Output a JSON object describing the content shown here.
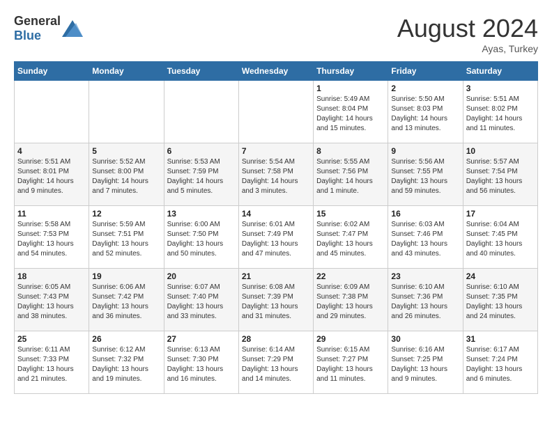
{
  "header": {
    "logo_general": "General",
    "logo_blue": "Blue",
    "month_year": "August 2024",
    "location": "Ayas, Turkey"
  },
  "days_of_week": [
    "Sunday",
    "Monday",
    "Tuesday",
    "Wednesday",
    "Thursday",
    "Friday",
    "Saturday"
  ],
  "weeks": [
    [
      {
        "day": "",
        "content": ""
      },
      {
        "day": "",
        "content": ""
      },
      {
        "day": "",
        "content": ""
      },
      {
        "day": "",
        "content": ""
      },
      {
        "day": "1",
        "content": "Sunrise: 5:49 AM\nSunset: 8:04 PM\nDaylight: 14 hours\nand 15 minutes."
      },
      {
        "day": "2",
        "content": "Sunrise: 5:50 AM\nSunset: 8:03 PM\nDaylight: 14 hours\nand 13 minutes."
      },
      {
        "day": "3",
        "content": "Sunrise: 5:51 AM\nSunset: 8:02 PM\nDaylight: 14 hours\nand 11 minutes."
      }
    ],
    [
      {
        "day": "4",
        "content": "Sunrise: 5:51 AM\nSunset: 8:01 PM\nDaylight: 14 hours\nand 9 minutes."
      },
      {
        "day": "5",
        "content": "Sunrise: 5:52 AM\nSunset: 8:00 PM\nDaylight: 14 hours\nand 7 minutes."
      },
      {
        "day": "6",
        "content": "Sunrise: 5:53 AM\nSunset: 7:59 PM\nDaylight: 14 hours\nand 5 minutes."
      },
      {
        "day": "7",
        "content": "Sunrise: 5:54 AM\nSunset: 7:58 PM\nDaylight: 14 hours\nand 3 minutes."
      },
      {
        "day": "8",
        "content": "Sunrise: 5:55 AM\nSunset: 7:56 PM\nDaylight: 14 hours\nand 1 minute."
      },
      {
        "day": "9",
        "content": "Sunrise: 5:56 AM\nSunset: 7:55 PM\nDaylight: 13 hours\nand 59 minutes."
      },
      {
        "day": "10",
        "content": "Sunrise: 5:57 AM\nSunset: 7:54 PM\nDaylight: 13 hours\nand 56 minutes."
      }
    ],
    [
      {
        "day": "11",
        "content": "Sunrise: 5:58 AM\nSunset: 7:53 PM\nDaylight: 13 hours\nand 54 minutes."
      },
      {
        "day": "12",
        "content": "Sunrise: 5:59 AM\nSunset: 7:51 PM\nDaylight: 13 hours\nand 52 minutes."
      },
      {
        "day": "13",
        "content": "Sunrise: 6:00 AM\nSunset: 7:50 PM\nDaylight: 13 hours\nand 50 minutes."
      },
      {
        "day": "14",
        "content": "Sunrise: 6:01 AM\nSunset: 7:49 PM\nDaylight: 13 hours\nand 47 minutes."
      },
      {
        "day": "15",
        "content": "Sunrise: 6:02 AM\nSunset: 7:47 PM\nDaylight: 13 hours\nand 45 minutes."
      },
      {
        "day": "16",
        "content": "Sunrise: 6:03 AM\nSunset: 7:46 PM\nDaylight: 13 hours\nand 43 minutes."
      },
      {
        "day": "17",
        "content": "Sunrise: 6:04 AM\nSunset: 7:45 PM\nDaylight: 13 hours\nand 40 minutes."
      }
    ],
    [
      {
        "day": "18",
        "content": "Sunrise: 6:05 AM\nSunset: 7:43 PM\nDaylight: 13 hours\nand 38 minutes."
      },
      {
        "day": "19",
        "content": "Sunrise: 6:06 AM\nSunset: 7:42 PM\nDaylight: 13 hours\nand 36 minutes."
      },
      {
        "day": "20",
        "content": "Sunrise: 6:07 AM\nSunset: 7:40 PM\nDaylight: 13 hours\nand 33 minutes."
      },
      {
        "day": "21",
        "content": "Sunrise: 6:08 AM\nSunset: 7:39 PM\nDaylight: 13 hours\nand 31 minutes."
      },
      {
        "day": "22",
        "content": "Sunrise: 6:09 AM\nSunset: 7:38 PM\nDaylight: 13 hours\nand 29 minutes."
      },
      {
        "day": "23",
        "content": "Sunrise: 6:10 AM\nSunset: 7:36 PM\nDaylight: 13 hours\nand 26 minutes."
      },
      {
        "day": "24",
        "content": "Sunrise: 6:10 AM\nSunset: 7:35 PM\nDaylight: 13 hours\nand 24 minutes."
      }
    ],
    [
      {
        "day": "25",
        "content": "Sunrise: 6:11 AM\nSunset: 7:33 PM\nDaylight: 13 hours\nand 21 minutes."
      },
      {
        "day": "26",
        "content": "Sunrise: 6:12 AM\nSunset: 7:32 PM\nDaylight: 13 hours\nand 19 minutes."
      },
      {
        "day": "27",
        "content": "Sunrise: 6:13 AM\nSunset: 7:30 PM\nDaylight: 13 hours\nand 16 minutes."
      },
      {
        "day": "28",
        "content": "Sunrise: 6:14 AM\nSunset: 7:29 PM\nDaylight: 13 hours\nand 14 minutes."
      },
      {
        "day": "29",
        "content": "Sunrise: 6:15 AM\nSunset: 7:27 PM\nDaylight: 13 hours\nand 11 minutes."
      },
      {
        "day": "30",
        "content": "Sunrise: 6:16 AM\nSunset: 7:25 PM\nDaylight: 13 hours\nand 9 minutes."
      },
      {
        "day": "31",
        "content": "Sunrise: 6:17 AM\nSunset: 7:24 PM\nDaylight: 13 hours\nand 6 minutes."
      }
    ]
  ]
}
